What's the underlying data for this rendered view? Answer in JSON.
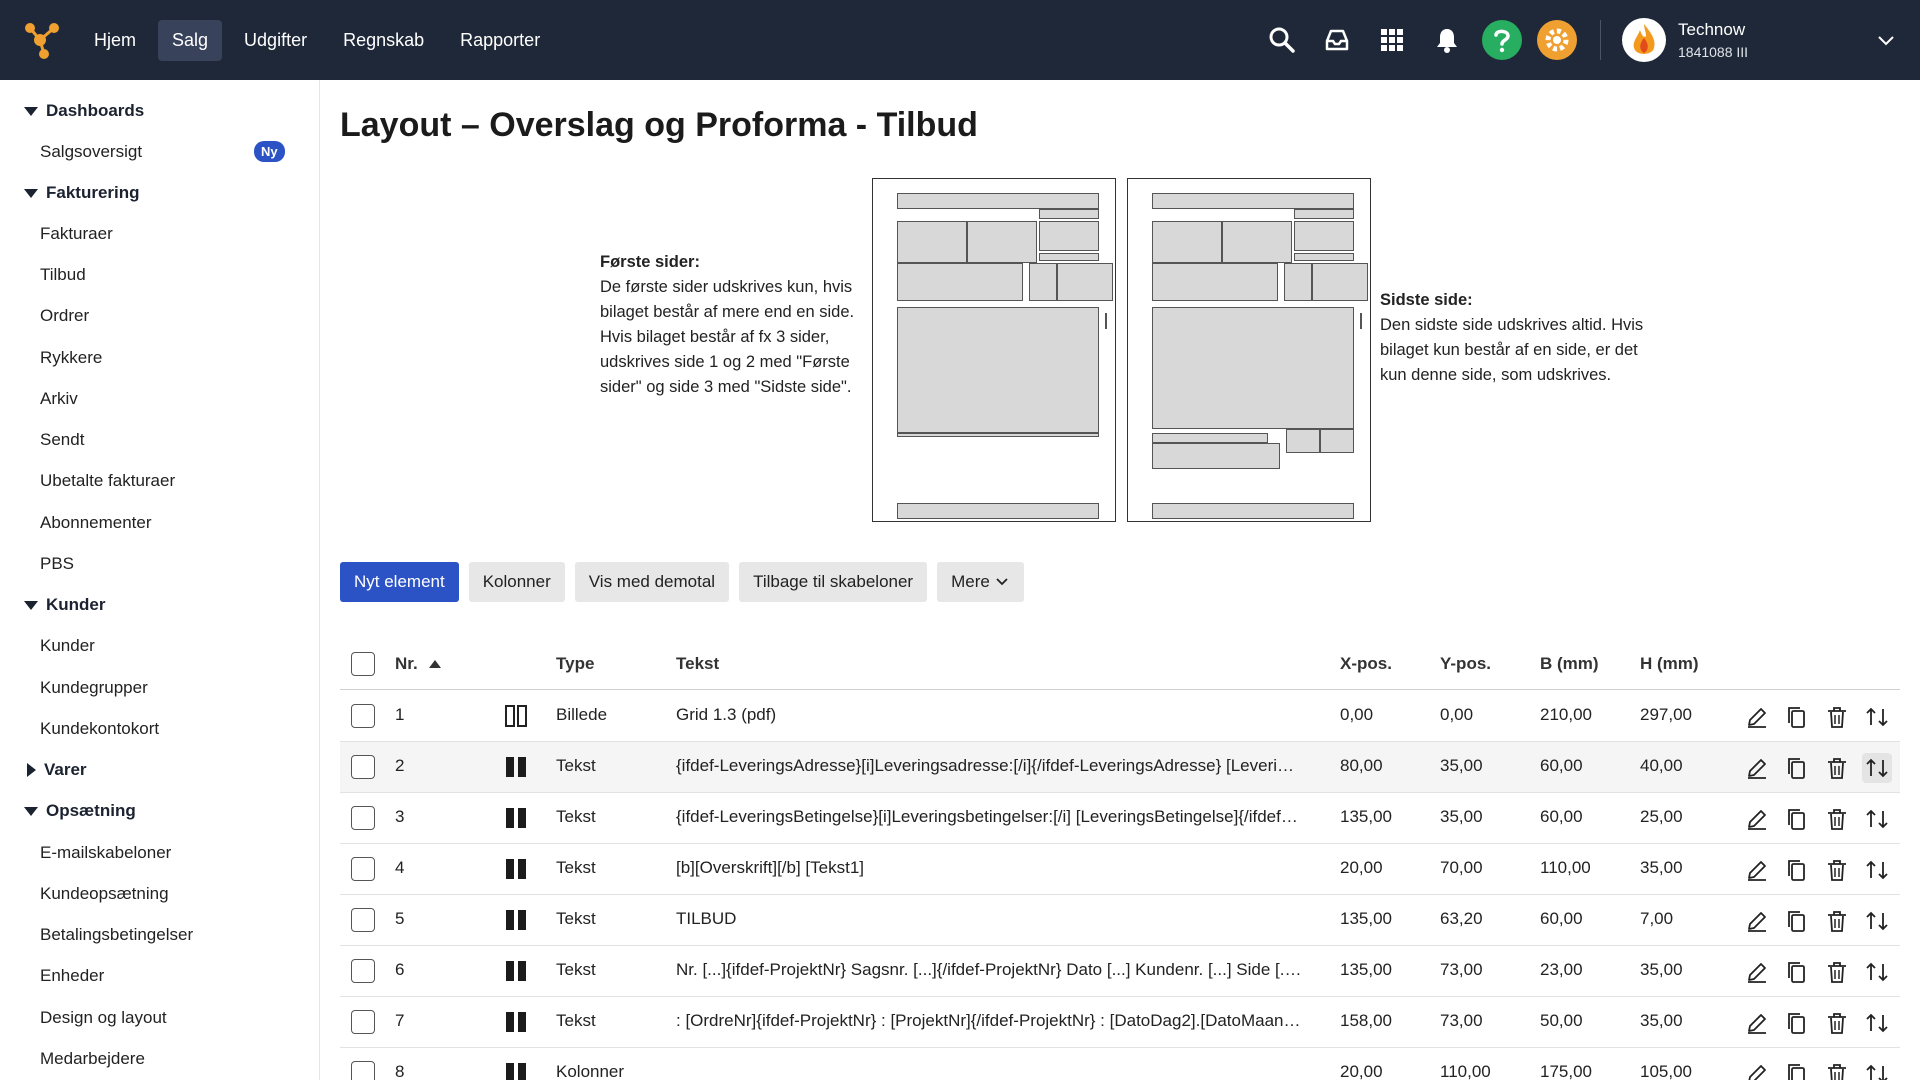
{
  "nav": {
    "items": [
      {
        "label": "Hjem",
        "active": false
      },
      {
        "label": "Salg",
        "active": true
      },
      {
        "label": "Udgifter",
        "active": false
      },
      {
        "label": "Regnskab",
        "active": false
      },
      {
        "label": "Rapporter",
        "active": false
      }
    ]
  },
  "user": {
    "name": "Technow",
    "id": "1841088 III"
  },
  "sidebar": {
    "groups": [
      {
        "label": "Dashboards",
        "expanded": true,
        "items": [
          "Salgsoversigt"
        ]
      },
      {
        "label": "Fakturering",
        "expanded": true,
        "items": [
          "Fakturaer",
          "Tilbud",
          "Ordrer",
          "Rykkere",
          "Arkiv",
          "Sendt",
          "Ubetalte fakturaer",
          "Abonnementer",
          "PBS"
        ]
      },
      {
        "label": "Kunder",
        "expanded": true,
        "items": [
          "Kunder",
          "Kundegrupper",
          "Kundekontokort"
        ]
      },
      {
        "label": "Varer",
        "expanded": false,
        "items": []
      },
      {
        "label": "Opsætning",
        "expanded": true,
        "items": [
          "E-mailskabeloner",
          "Kundeopsætning",
          "Betalingsbetingelser",
          "Enheder",
          "Design og layout",
          "Medarbejdere"
        ]
      }
    ],
    "badge": "Ny"
  },
  "page": {
    "title": "Layout – Overslag og Proforma - Tilbud"
  },
  "first_pages": {
    "title": "Første sider:",
    "text": "De første sider udskrives kun, hvis bilaget består af mere end en side. Hvis bilaget består af fx 3 sider, udskrives side 1 og 2 med \"Første sider\" og side 3 med \"Sidste side\"."
  },
  "last_page": {
    "title": "Sidste side:",
    "text": "Den sidste side udskrives altid. Hvis bilaget kun består af en side, er det kun denne side, som udskrives."
  },
  "buttons": {
    "new": "Nyt element",
    "columns": "Kolonner",
    "demo": "Vis med demotal",
    "back": "Tilbage til skabeloner",
    "more": "Mere"
  },
  "table": {
    "headers": {
      "nr": "Nr.",
      "type": "Type",
      "text": "Tekst",
      "x": "X-pos.",
      "y": "Y-pos.",
      "w": "B (mm)",
      "h": "H (mm)"
    },
    "rows": [
      {
        "nr": "1",
        "type": "Billede",
        "text": "Grid 1.3 (pdf)",
        "x": "0,00",
        "y": "0,00",
        "w": "210,00",
        "h": "297,00",
        "icon": "image-columns"
      },
      {
        "nr": "2",
        "type": "Tekst",
        "text": "{ifdef-LeveringsAdresse}[i]Leveringsadresse:[/i]{/ifdef-LeveringsAdresse} [Leveri…",
        "x": "80,00",
        "y": "35,00",
        "w": "60,00",
        "h": "40,00",
        "icon": "text-columns"
      },
      {
        "nr": "3",
        "type": "Tekst",
        "text": "{ifdef-LeveringsBetingelse}[i]Leveringsbetingelser:[/i] [LeveringsBetingelse]{/ifdef…",
        "x": "135,00",
        "y": "35,00",
        "w": "60,00",
        "h": "25,00",
        "icon": "text-columns"
      },
      {
        "nr": "4",
        "type": "Tekst",
        "text": "[b][Overskrift][/b] [Tekst1]",
        "x": "20,00",
        "y": "70,00",
        "w": "110,00",
        "h": "35,00",
        "icon": "text-columns"
      },
      {
        "nr": "5",
        "type": "Tekst",
        "text": "TILBUD",
        "x": "135,00",
        "y": "63,20",
        "w": "60,00",
        "h": "7,00",
        "icon": "text-columns"
      },
      {
        "nr": "6",
        "type": "Tekst",
        "text": "Nr. [...]{ifdef-ProjektNr} Sagsnr. [...]{/ifdef-ProjektNr} Dato [...] Kundenr. [...] Side [.…",
        "x": "135,00",
        "y": "73,00",
        "w": "23,00",
        "h": "35,00",
        "icon": "text-columns"
      },
      {
        "nr": "7",
        "type": "Tekst",
        "text": ": [OrdreNr]{ifdef-ProjektNr} : [ProjektNr]{/ifdef-ProjektNr} : [DatoDag2].[DatoMaan…",
        "x": "158,00",
        "y": "73,00",
        "w": "50,00",
        "h": "35,00",
        "icon": "text-columns"
      },
      {
        "nr": "8",
        "type": "Kolonner",
        "text": "",
        "x": "20,00",
        "y": "110,00",
        "w": "175,00",
        "h": "105,00",
        "icon": "text-columns"
      }
    ]
  },
  "colors": {
    "topbar": "#1f2838",
    "primary": "#2c53c6",
    "help": "#27ae60",
    "gear": "#f0a030"
  }
}
